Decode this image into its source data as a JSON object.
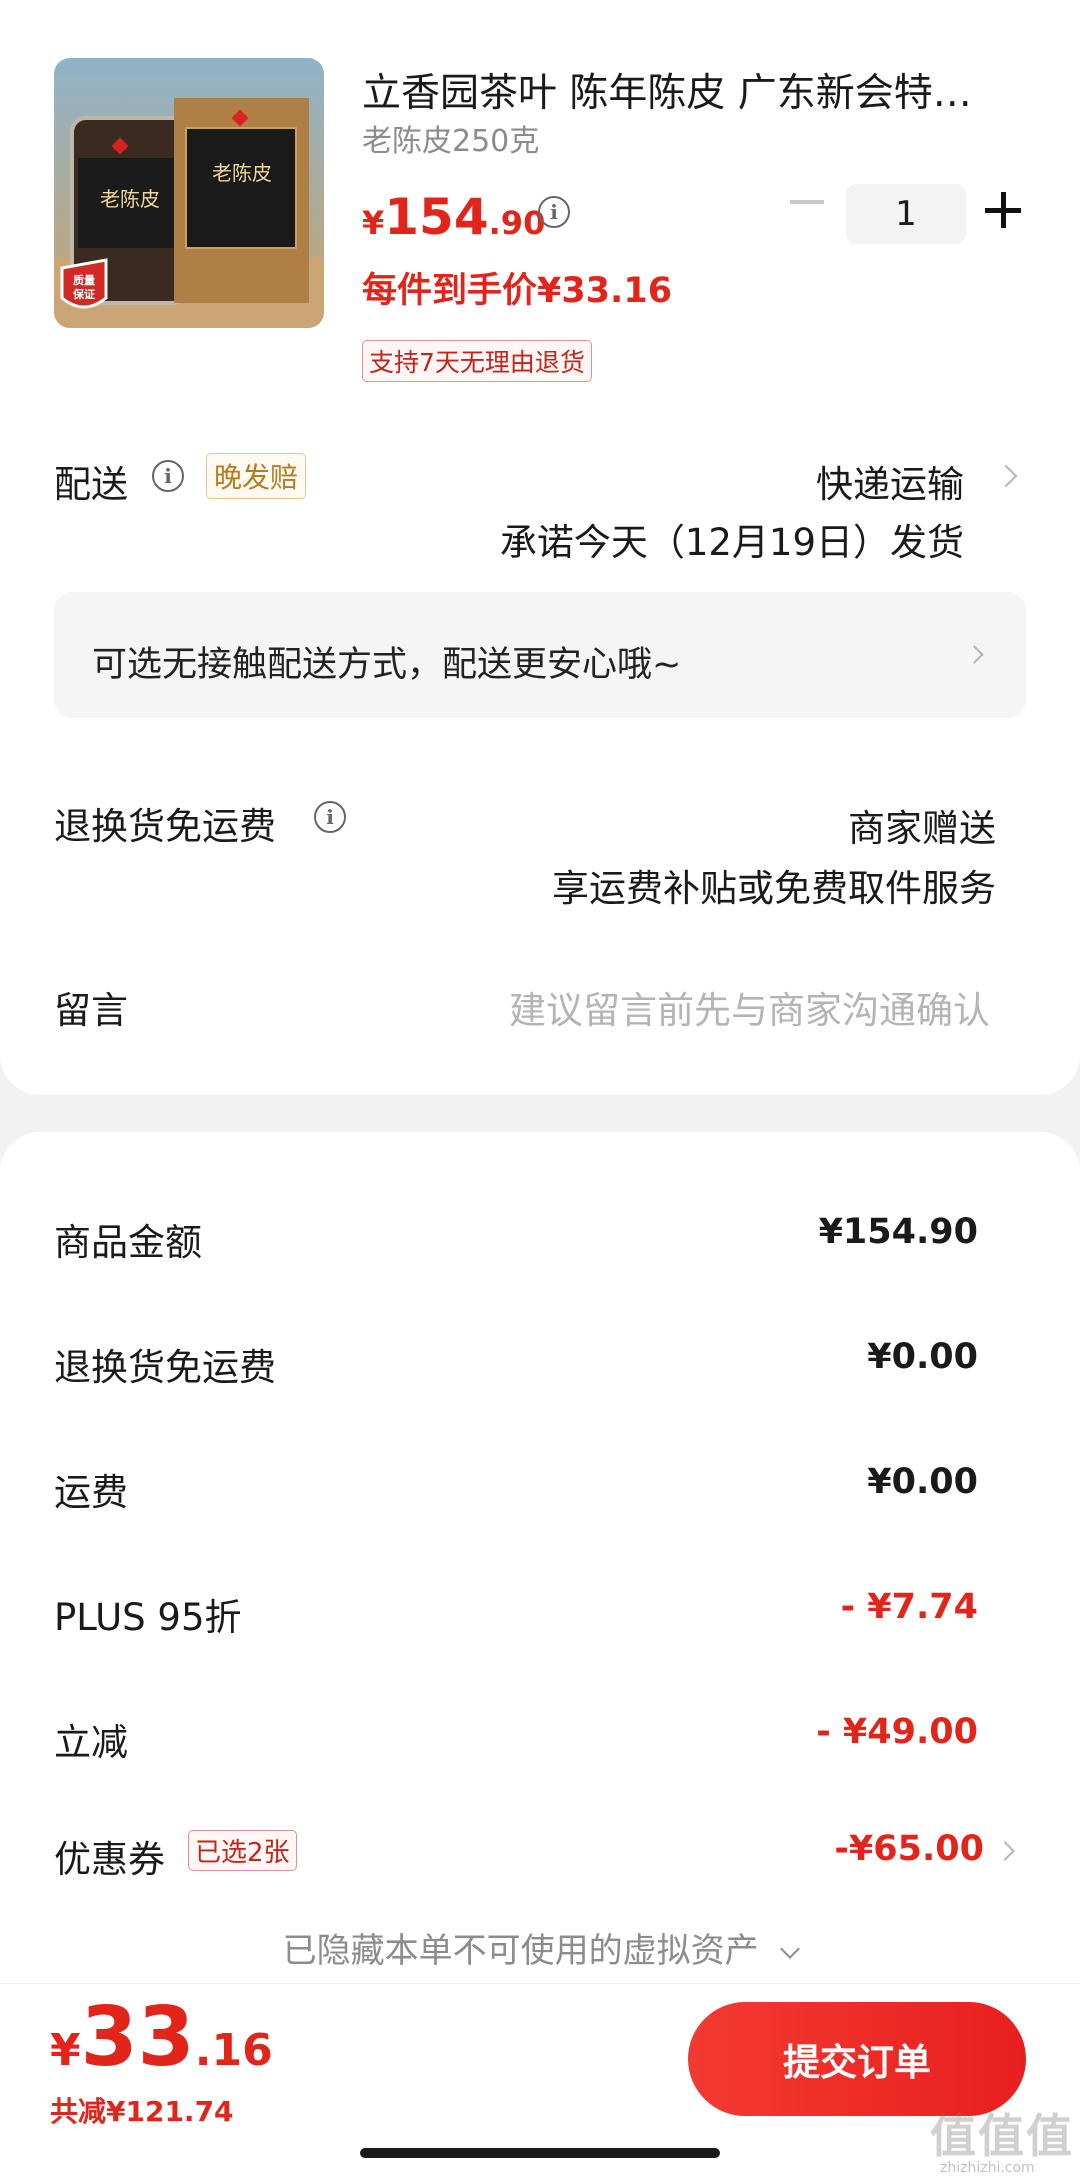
{
  "product": {
    "title": "立香园茶叶 陈年陈皮 广东新会特产...",
    "spec": "老陈皮250克",
    "price_symbol": "¥",
    "price_int": "154",
    "price_dec": ".90",
    "unit_price": "每件到手价¥33.16",
    "return_tag": "支持7天无理由退货",
    "image_label": "老陈皮",
    "quality_badge": "质量\n保证",
    "quantity": "1"
  },
  "delivery": {
    "label": "配送",
    "late_tag": "晚发赔",
    "method": "快递运输",
    "promise": "承诺今天（12月19日）发货",
    "contactless": "可选无接触配送方式，配送更安心哦~"
  },
  "return_shipping": {
    "label": "退换货免运费",
    "value": "商家赠送",
    "sub": "享运费补贴或免费取件服务"
  },
  "message": {
    "label": "留言",
    "placeholder": "建议留言前先与商家沟通确认"
  },
  "summary": {
    "goods_label": "商品金额",
    "goods_value": "¥154.90",
    "return_fee_label": "退换货免运费",
    "return_fee_value": "¥0.00",
    "shipping_label": "运费",
    "shipping_value": "¥0.00",
    "plus_label": "PLUS 95折",
    "plus_value": "- ¥7.74",
    "instant_label": "立减",
    "instant_value": "- ¥49.00",
    "coupon_label": "优惠券",
    "coupon_tag": "已选2张",
    "coupon_value": "-¥65.00",
    "hidden_assets": "已隐藏本单不可使用的虚拟资产"
  },
  "footer": {
    "total_symbol": "¥",
    "total_int": "33",
    "total_dec": ".16",
    "total_saved": "共减¥121.74",
    "submit": "提交订单",
    "watermark": "值值值",
    "watermark_sub": "zhizhizhi.com"
  },
  "colors": {
    "accent": "#e1251b",
    "gold_tag": "#b77b1f",
    "page_bg": "#f2f2f2"
  }
}
